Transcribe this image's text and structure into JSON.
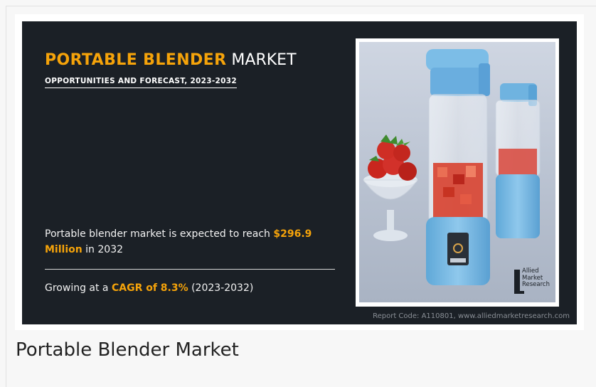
{
  "banner": {
    "title_highlight": "PORTABLE BLENDER",
    "title_rest": " MARKET",
    "subtitle": "OPPORTUNITIES AND FORECAST, 2023-2032",
    "stat1": {
      "prefix": "Portable blender market is expected to reach ",
      "value": "$296.9 Million",
      "suffix": " in 2032"
    },
    "stat2": {
      "prefix": "Growing at a ",
      "value": "CAGR of 8.3%",
      "suffix": " (2023-2032)"
    },
    "report_code": "Report Code: A110801, www.alliedmarketresearch.com",
    "logo_text": "Allied\nMarket\nResearch",
    "colors": {
      "background": "#1b2026",
      "accent": "#f5a30a",
      "text": "#ffffff"
    }
  },
  "caption": "Portable Blender Market"
}
